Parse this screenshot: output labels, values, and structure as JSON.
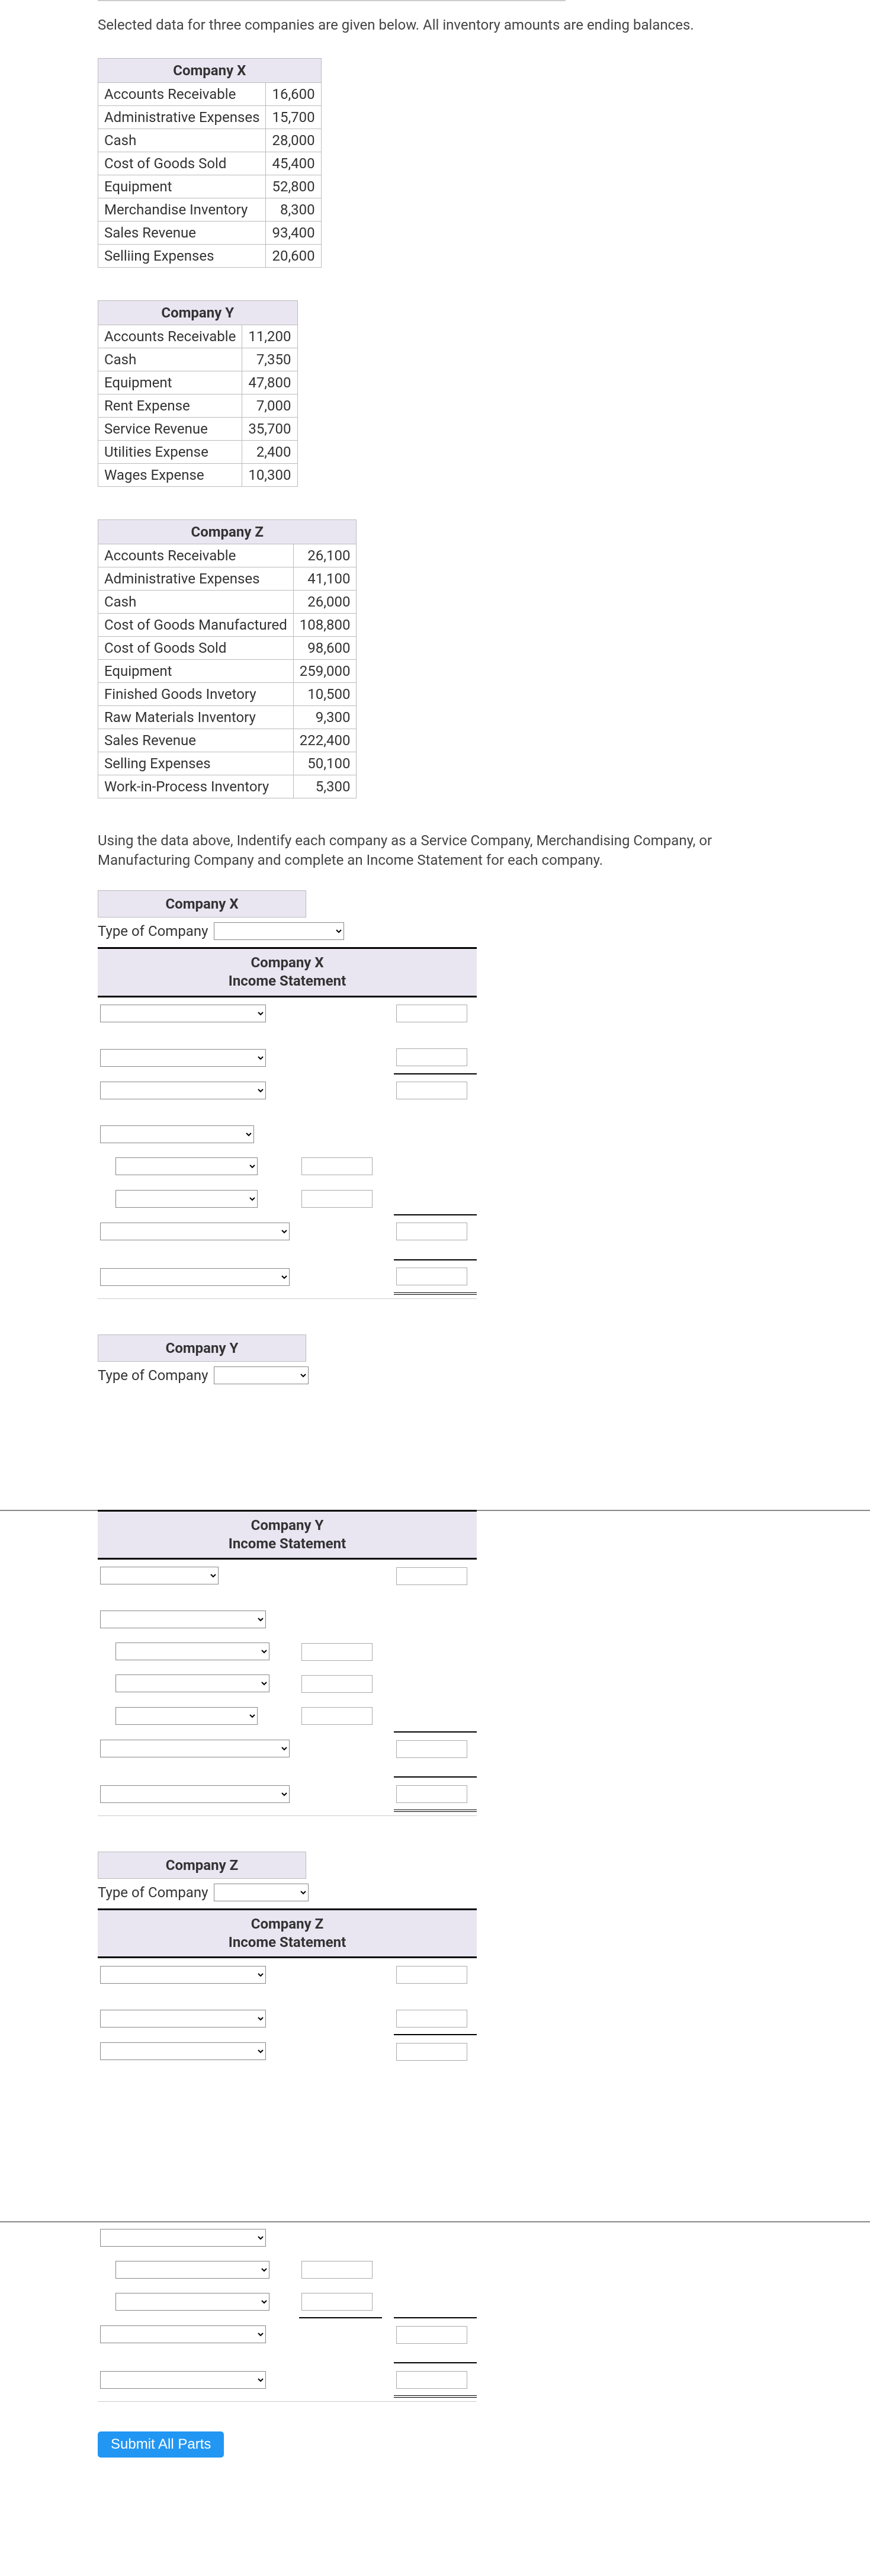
{
  "intro": "Selected data for three companies are given below. All inventory amounts are ending balances.",
  "companyX": {
    "name": "Company X",
    "rows": [
      {
        "label": "Accounts Receivable",
        "value": "16,600"
      },
      {
        "label": "Administrative Expenses",
        "value": "15,700"
      },
      {
        "label": "Cash",
        "value": "28,000"
      },
      {
        "label": "Cost of Goods Sold",
        "value": "45,400"
      },
      {
        "label": "Equipment",
        "value": "52,800"
      },
      {
        "label": "Merchandise Inventory",
        "value": "8,300"
      },
      {
        "label": "Sales Revenue",
        "value": "93,400"
      },
      {
        "label": "Selliing Expenses",
        "value": "20,600"
      }
    ]
  },
  "companyY": {
    "name": "Company Y",
    "rows": [
      {
        "label": "Accounts Receivable",
        "value": "11,200"
      },
      {
        "label": "Cash",
        "value": "7,350"
      },
      {
        "label": "Equipment",
        "value": "47,800"
      },
      {
        "label": "Rent Expense",
        "value": "7,000"
      },
      {
        "label": "Service Revenue",
        "value": "35,700"
      },
      {
        "label": "Utilities Expense",
        "value": "2,400"
      },
      {
        "label": "Wages Expense",
        "value": "10,300"
      }
    ]
  },
  "companyZ": {
    "name": "Company Z",
    "rows": [
      {
        "label": "Accounts Receivable",
        "value": "26,100"
      },
      {
        "label": "Administrative Expenses",
        "value": "41,100"
      },
      {
        "label": "Cash",
        "value": "26,000"
      },
      {
        "label": "Cost of Goods Manufactured",
        "value": "108,800"
      },
      {
        "label": "Cost of Goods Sold",
        "value": "98,600"
      },
      {
        "label": "Equipment",
        "value": "259,000"
      },
      {
        "label": "Finished Goods Invetory",
        "value": "10,500"
      },
      {
        "label": "Raw Materials Inventory",
        "value": "9,300"
      },
      {
        "label": "Sales Revenue",
        "value": "222,400"
      },
      {
        "label": "Selling Expenses",
        "value": "50,100"
      },
      {
        "label": "Work-in-Process Inventory",
        "value": "5,300"
      }
    ]
  },
  "instr": "Using the data above, Indentify each company as a Service Company, Merchandising Company, or Manufacturing Company and complete an Income Statement for each company.",
  "typeLabel": "Type of Company",
  "stmtX": {
    "title1": "Company X",
    "title2": "Income Statement"
  },
  "stmtY": {
    "title1": "Company Y",
    "title2": "Income Statement"
  },
  "stmtZ": {
    "title1": "Company Z",
    "title2": "Income Statement"
  },
  "submit": "Submit All Parts"
}
